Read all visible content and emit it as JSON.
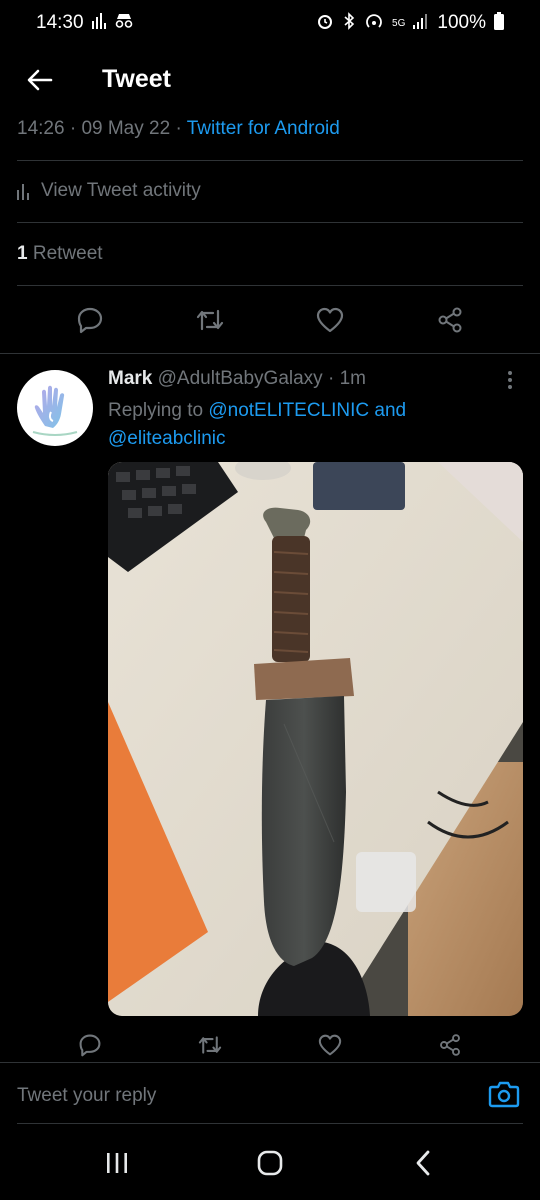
{
  "status_bar": {
    "time": "14:30",
    "network": "5G",
    "battery": "100%"
  },
  "header": {
    "title": "Tweet"
  },
  "tweet_meta": {
    "time": "14:26",
    "separator": "·",
    "date": "09 May 22",
    "client": "Twitter for Android"
  },
  "activity": {
    "label": "View Tweet activity"
  },
  "stats": {
    "retweet_count": "1",
    "retweet_label": "Retweet"
  },
  "reply": {
    "name": "Mark",
    "handle": "@AdultBabyGalaxy",
    "dot": "·",
    "time_ago": "1m",
    "replying_prefix": "Replying to",
    "mention_1": "@notELITECLINIC",
    "and": "and",
    "mention_2": "@eliteabclinic",
    "more": "⋮"
  },
  "composer": {
    "placeholder": "Tweet your reply"
  },
  "colors": {
    "background": "#000000",
    "accent": "#1d9bf0",
    "muted": "#71767b",
    "divider": "#2f3336"
  },
  "icons": [
    "back-arrow-icon",
    "bars-icon",
    "reply-icon",
    "retweet-icon",
    "like-icon",
    "share-icon",
    "camera-icon",
    "recents-icon",
    "home-icon",
    "nav-back-icon"
  ]
}
